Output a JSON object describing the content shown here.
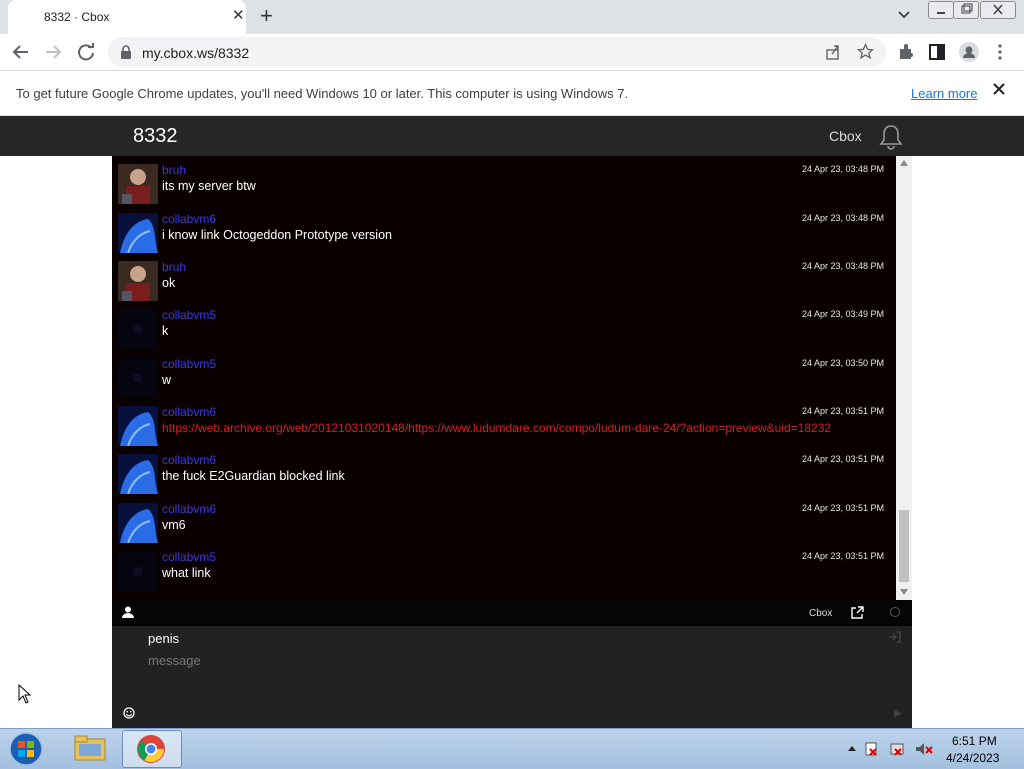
{
  "browser": {
    "tab_title": "8332 · Cbox",
    "url": "my.cbox.ws/8332",
    "infobar_text": "To get future Google Chrome updates, you'll need Windows 10 or later. This computer is using Windows 7.",
    "infobar_link": "Learn more"
  },
  "page": {
    "box_title": "8332",
    "brand": "Cbox"
  },
  "messages": [
    {
      "name": "bruh",
      "text": "its my server btw",
      "time": "24 Apr 23, 03:48 PM",
      "avatar": "bruh"
    },
    {
      "name": "collabvm6",
      "text": "i know link Octogeddon Prototype version",
      "time": "24 Apr 23, 03:48 PM",
      "avatar": "vm6"
    },
    {
      "name": "bruh",
      "text": "ok",
      "time": "24 Apr 23, 03:48 PM",
      "avatar": "bruh"
    },
    {
      "name": "collabvm5",
      "text": "k",
      "time": "24 Apr 23, 03:49 PM",
      "avatar": "vm5"
    },
    {
      "name": "collabvm5",
      "text": "w",
      "time": "24 Apr 23, 03:50 PM",
      "avatar": "vm5"
    },
    {
      "name": "collabvm6",
      "text": "https://web.archive.org/web/20121031020148/https://www.ludumdare.com/compo/ludum-dare-24/?action=preview&uid=18232",
      "time": "24 Apr 23, 03:51 PM",
      "avatar": "vm6",
      "is_link": true
    },
    {
      "name": "collabvm6",
      "text": "the fuck E2Guardian blocked link",
      "time": "24 Apr 23, 03:51 PM",
      "avatar": "vm6"
    },
    {
      "name": "collabvm6",
      "text": "vm6",
      "time": "24 Apr 23, 03:51 PM",
      "avatar": "vm6"
    },
    {
      "name": "collabvm5",
      "text": "what link",
      "time": "24 Apr 23, 03:51 PM",
      "avatar": "vm5"
    }
  ],
  "footer": {
    "brand": "Cbox"
  },
  "composer": {
    "name_value": "penis",
    "message_placeholder": "message"
  },
  "taskbar": {
    "time": "6:51 PM",
    "date": "4/24/2023"
  },
  "colors": {
    "topbar": "#262626",
    "chat_bg": "#0a0000",
    "username": "#3a3ae0",
    "link": "#d42020"
  }
}
